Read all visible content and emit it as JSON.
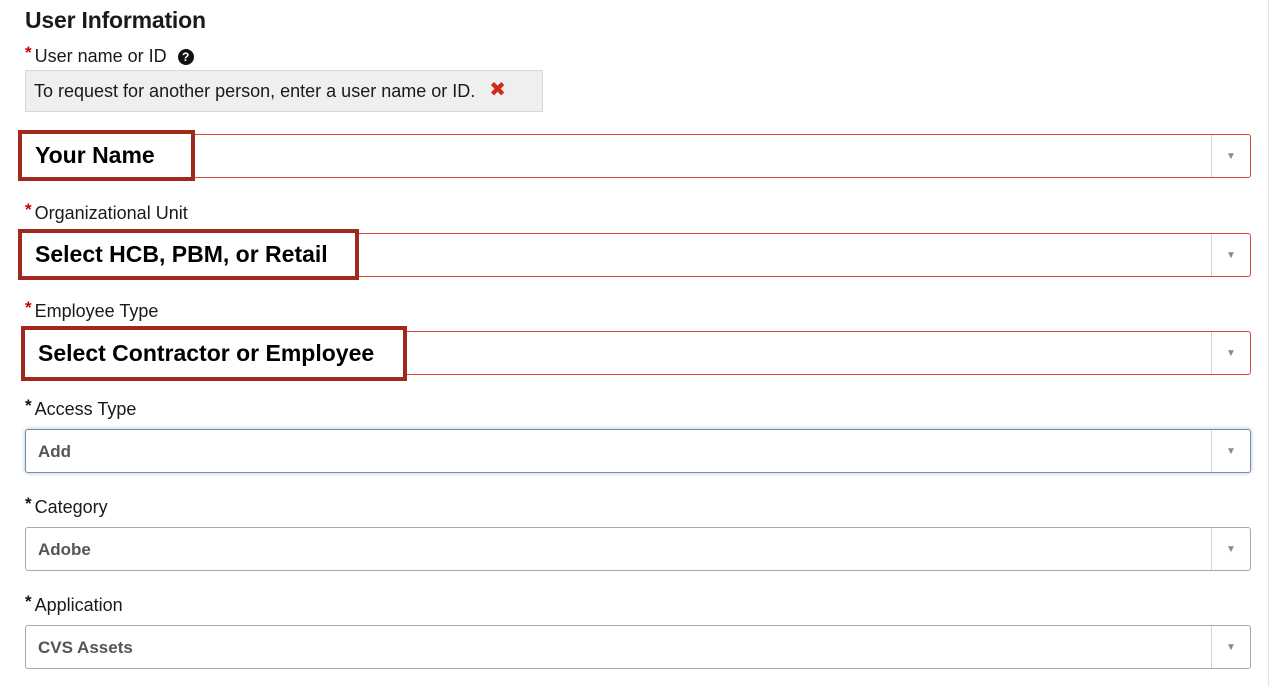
{
  "section": {
    "title": "User Information"
  },
  "user_name": {
    "label": "User name or ID",
    "required_marker": "*",
    "help_icon": "question-circle-icon",
    "hint": "To request for another person, enter a user name or ID.",
    "hint_close_icon": "close-x-icon",
    "callout": "Your Name"
  },
  "org_unit": {
    "label": "Organizational Unit",
    "required_marker": "*",
    "callout": "Select HCB, PBM, or Retail"
  },
  "employee_type": {
    "label": "Employee Type",
    "required_marker": "*",
    "callout": "Select Contractor or Employee"
  },
  "access_type": {
    "label": "Access Type",
    "required_marker": "*",
    "value": "Add"
  },
  "category": {
    "label": "Category",
    "required_marker": "*",
    "value": "Adobe"
  },
  "application": {
    "label": "Application",
    "required_marker": "*",
    "value": "CVS Assets"
  },
  "dropdown_arrow": "▼",
  "colors": {
    "error_border": "#d64a3f",
    "required_red": "#cc0000",
    "callout_border": "#a0281c",
    "hint_bg": "#efefef"
  }
}
